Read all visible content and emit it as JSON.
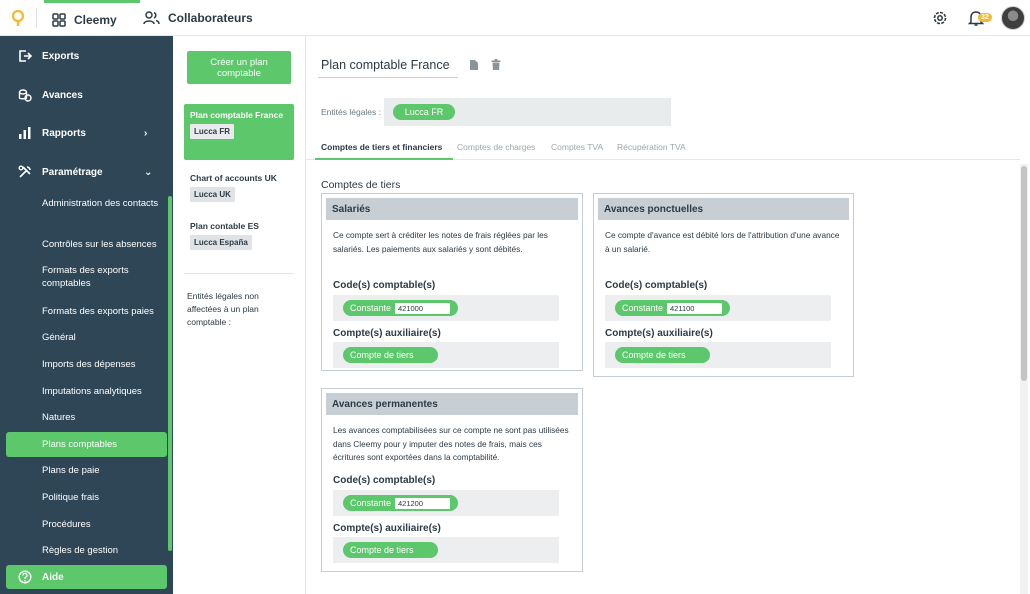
{
  "topbar": {
    "apps": [
      {
        "label": "Cleemy",
        "icon": "grid-icon",
        "active": true
      },
      {
        "label": "Collaborateurs",
        "icon": "users-icon",
        "active": false
      }
    ],
    "notifications_count": "32",
    "colors": {
      "accent": "#5cc76b",
      "badge": "#f6b830"
    }
  },
  "sidebar": {
    "main_items": [
      {
        "label": "Exports",
        "icon": "export-icon"
      },
      {
        "label": "Avances",
        "icon": "coins-icon"
      },
      {
        "label": "Rapports",
        "icon": "bar-chart-icon",
        "chevron": "›"
      },
      {
        "label": "Paramétrage",
        "icon": "tools-icon",
        "chevron": "⌄"
      }
    ],
    "sub_items": [
      {
        "label": "Administration des contacts"
      },
      {
        "label": "Contrôles sur les absences"
      },
      {
        "label": "Formats des exports comptables"
      },
      {
        "label": "Formats des exports paies"
      },
      {
        "label": "Général"
      },
      {
        "label": "Imports des dépenses"
      },
      {
        "label": "Imputations analytiques"
      },
      {
        "label": "Natures"
      },
      {
        "label": "Plans comptables",
        "active": true
      },
      {
        "label": "Plans de paie"
      },
      {
        "label": "Politique frais"
      },
      {
        "label": "Procédures"
      },
      {
        "label": "Règles de gestion"
      }
    ],
    "help_label": "Aide",
    "colors": {
      "background": "#2e4656",
      "active": "#5cc76b"
    }
  },
  "plans": {
    "create_label": "Créer un plan comptable",
    "items": [
      {
        "name": "Plan comptable France",
        "entity": "Lucca FR",
        "active": true
      },
      {
        "name": "Chart of accounts UK",
        "entity": "Lucca UK",
        "active": false
      },
      {
        "name": "Plan contable ES",
        "entity": "Lucca España",
        "active": false
      }
    ],
    "unassigned_label": "Entités légales non affectées à un plan comptable :"
  },
  "main": {
    "plan_name": "Plan comptable France",
    "entities_label": "Entités légales :",
    "entities": [
      "Lucca FR"
    ],
    "tabs": [
      {
        "label": "Comptes de tiers et financiers",
        "active": true
      },
      {
        "label": "Comptes de charges"
      },
      {
        "label": "Comptes TVA"
      },
      {
        "label": "Récupération TVA"
      }
    ],
    "section_title": "Comptes de tiers",
    "code_label": "Code(s) comptable(s)",
    "aux_label": "Compte(s) auxiliaire(s)",
    "constant_label": "Constante",
    "tiers_label": "Compte de tiers",
    "cards": [
      {
        "title": "Salariés",
        "description": "Ce compte sert à créditer les notes de frais réglées par les salariés. Les paiements aux salariés y sont débités.",
        "code": "421000"
      },
      {
        "title": "Avances ponctuelles",
        "description": "Ce compte d'avance est débité lors de l'attribution d'une avance à un salarié.",
        "code": "421100"
      },
      {
        "title": "Avances permanentes",
        "description": "Les avances comptabilisées sur ce compte ne sont pas utilisées dans Cleemy pour y imputer des notes de frais, mais ces écritures sont exportées dans la comptabilité.",
        "code": "421200"
      }
    ]
  }
}
